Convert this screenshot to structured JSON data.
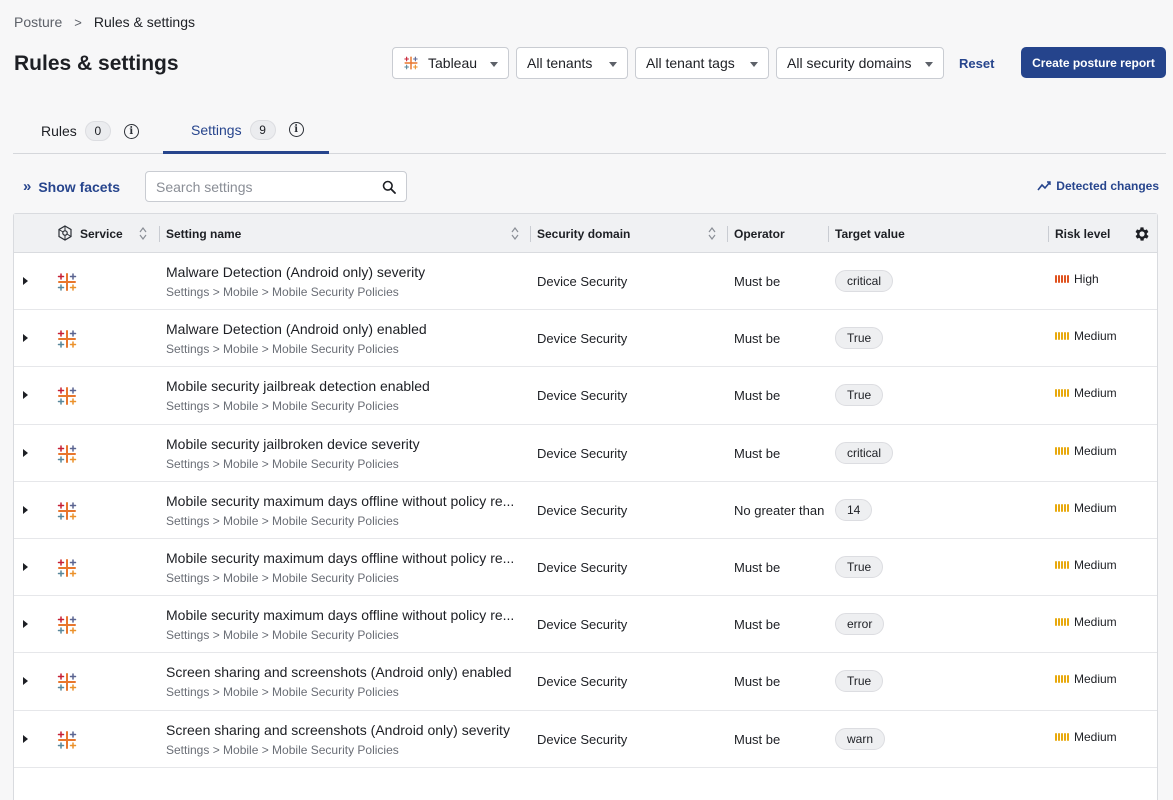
{
  "breadcrumb": {
    "root": "Posture",
    "separator": ">",
    "current": "Rules & settings"
  },
  "page_title": "Rules & settings",
  "filters": {
    "service": "Tableau",
    "tenants": "All tenants",
    "tenant_tags": "All tenant tags",
    "security_domains": "All security domains",
    "reset": "Reset"
  },
  "create_report_label": "Create posture report",
  "tabs": [
    {
      "label": "Rules",
      "count": "0",
      "active": false
    },
    {
      "label": "Settings",
      "count": "9",
      "active": true
    }
  ],
  "toolbar": {
    "show_facets": "Show facets",
    "search_placeholder": "Search settings",
    "detected_changes": "Detected changes"
  },
  "columns": {
    "service": "Service",
    "setting_name": "Setting name",
    "security_domain": "Security domain",
    "operator": "Operator",
    "target_value": "Target value",
    "risk_level": "Risk level"
  },
  "colors": {
    "accent": "#27458d",
    "risk_high": "#e0531f",
    "risk_medium": "#e8a90e"
  },
  "rows": [
    {
      "name": "Malware Detection (Android only) severity",
      "path": "Settings > Mobile > Mobile Security Policies",
      "domain": "Device Security",
      "operator": "Must be",
      "target": "critical",
      "risk": "High"
    },
    {
      "name": "Malware Detection (Android only) enabled",
      "path": "Settings > Mobile > Mobile Security Policies",
      "domain": "Device Security",
      "operator": "Must be",
      "target": "True",
      "risk": "Medium"
    },
    {
      "name": "Mobile security jailbreak detection enabled",
      "path": "Settings > Mobile > Mobile Security Policies",
      "domain": "Device Security",
      "operator": "Must be",
      "target": "True",
      "risk": "Medium"
    },
    {
      "name": "Mobile security jailbroken device severity",
      "path": "Settings > Mobile > Mobile Security Policies",
      "domain": "Device Security",
      "operator": "Must be",
      "target": "critical",
      "risk": "Medium"
    },
    {
      "name": "Mobile security maximum days offline without policy re...",
      "path": "Settings > Mobile > Mobile Security Policies",
      "domain": "Device Security",
      "operator": "No greater than",
      "target": "14",
      "risk": "Medium"
    },
    {
      "name": "Mobile security maximum days offline without policy re...",
      "path": "Settings > Mobile > Mobile Security Policies",
      "domain": "Device Security",
      "operator": "Must be",
      "target": "True",
      "risk": "Medium"
    },
    {
      "name": "Mobile security maximum days offline without policy re...",
      "path": "Settings > Mobile > Mobile Security Policies",
      "domain": "Device Security",
      "operator": "Must be",
      "target": "error",
      "risk": "Medium"
    },
    {
      "name": "Screen sharing and screenshots (Android only) enabled",
      "path": "Settings > Mobile > Mobile Security Policies",
      "domain": "Device Security",
      "operator": "Must be",
      "target": "True",
      "risk": "Medium"
    },
    {
      "name": "Screen sharing and screenshots (Android only) severity",
      "path": "Settings > Mobile > Mobile Security Policies",
      "domain": "Device Security",
      "operator": "Must be",
      "target": "warn",
      "risk": "Medium"
    }
  ]
}
